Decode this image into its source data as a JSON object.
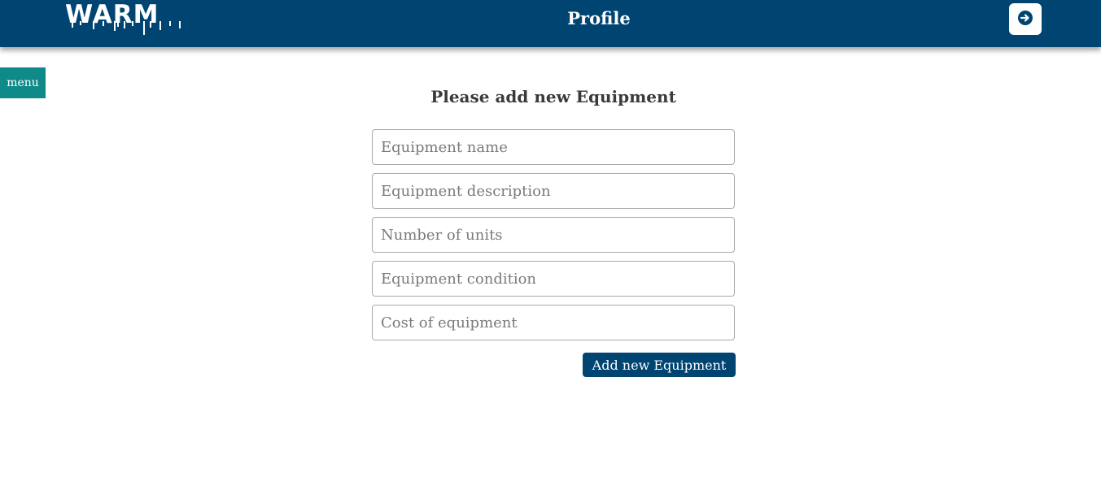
{
  "header": {
    "logo_text": "WARM",
    "title": "Profile",
    "logout_icon": "arrow-right-circle-icon"
  },
  "sidebar": {
    "menu_label": "menu"
  },
  "form": {
    "heading": "Please add new Equipment",
    "fields": [
      {
        "placeholder": "Equipment name",
        "value": ""
      },
      {
        "placeholder": "Equipment description",
        "value": ""
      },
      {
        "placeholder": "Number of units",
        "value": ""
      },
      {
        "placeholder": "Equipment condition",
        "value": ""
      },
      {
        "placeholder": "Cost of equipment",
        "value": ""
      }
    ],
    "submit_label": "Add new Equipment"
  },
  "colors": {
    "header_bg": "#004472",
    "menu_bg": "#108a89",
    "button_bg": "#004472"
  }
}
